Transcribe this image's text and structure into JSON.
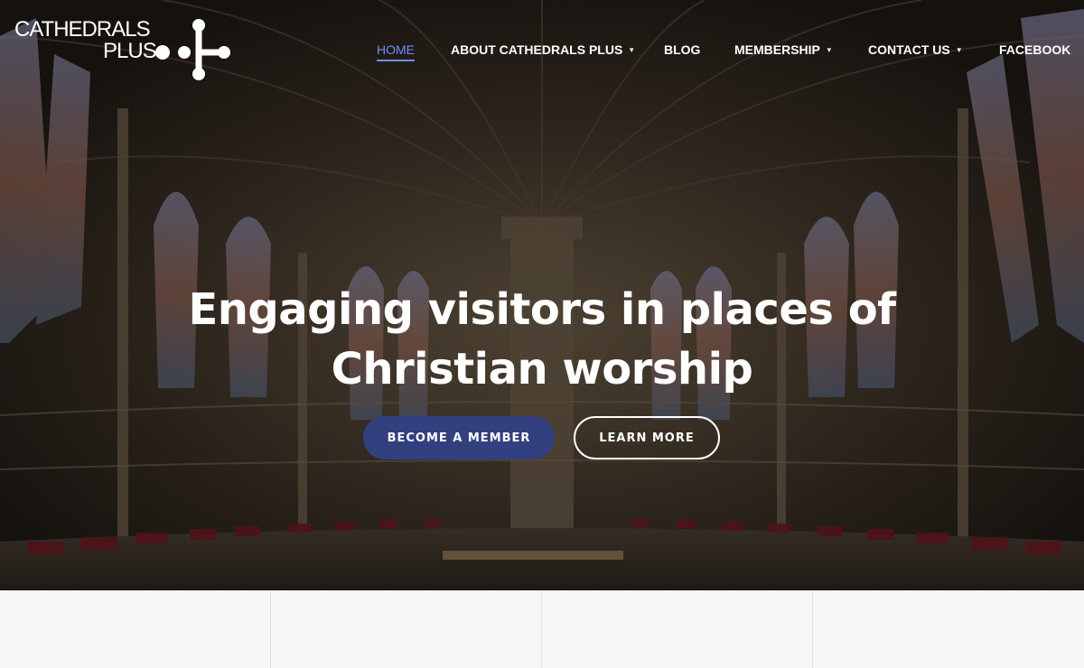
{
  "brand": {
    "line1": "CATHEDRALS",
    "line2": "PLUS"
  },
  "nav": {
    "items": [
      {
        "label": "HOME",
        "active": true,
        "dropdown": false
      },
      {
        "label": "ABOUT CATHEDRALS PLUS",
        "active": false,
        "dropdown": true
      },
      {
        "label": "BLOG",
        "active": false,
        "dropdown": false
      },
      {
        "label": "MEMBERSHIP",
        "active": false,
        "dropdown": true
      },
      {
        "label": "CONTACT US",
        "active": false,
        "dropdown": true
      },
      {
        "label": "FACEBOOK",
        "active": false,
        "dropdown": false
      }
    ]
  },
  "hero": {
    "headline_line1": "Engaging visitors in places of",
    "headline_line2": "Christian worship",
    "primary_button": "BECOME A MEMBER",
    "secondary_button": "LEARN MORE",
    "background_icon": "cathedral-interior-photo"
  },
  "colors": {
    "accent": "#6f8cff",
    "primary_button": "#33407f",
    "section_bg": "#f6f7f9"
  }
}
